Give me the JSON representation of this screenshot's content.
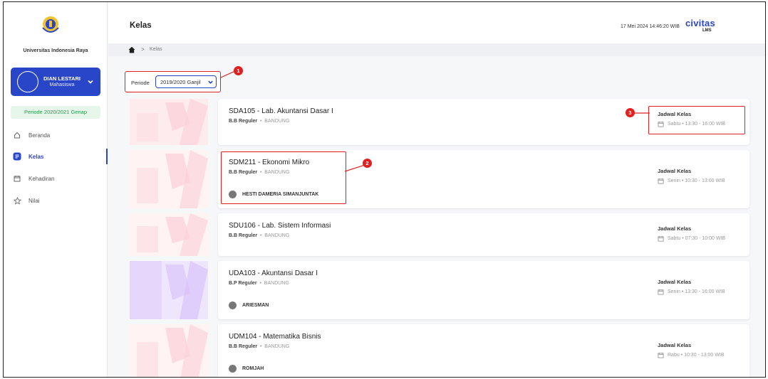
{
  "university": {
    "name": "Universitas Indonesia Raya",
    "logo_text": "Universitas Indonesia Raya"
  },
  "user": {
    "name": "DIAN LESTARI",
    "role": "Mahasiswa"
  },
  "sidebar": {
    "periode": "Periode 2020/2021 Genap",
    "items": [
      {
        "label": "Beranda",
        "icon": "home-outline-icon"
      },
      {
        "label": "Kelas",
        "icon": "class-icon",
        "active": true
      },
      {
        "label": "Kehadiran",
        "icon": "calendar-icon"
      },
      {
        "label": "Nilai",
        "icon": "star-icon"
      }
    ]
  },
  "header": {
    "title": "Kelas",
    "datetime": "17 Mei 2024 14:46:20 WIB",
    "brand": "civitas",
    "brand_sub": "LMS"
  },
  "breadcrumb": {
    "current": "Kelas",
    "separator": ">"
  },
  "filter": {
    "label": "Periode",
    "value": "2019/2020 Ganjil"
  },
  "markers": [
    "1",
    "2",
    "3"
  ],
  "schedule_heading": "Jadwal Kelas",
  "classes": [
    {
      "title": "SDA105 - Lab. Akuntansi Dasar I",
      "program": "B.B Reguler",
      "location": "BANDUNG",
      "lecturer": "",
      "schedule": "Sabtu • 13:30 - 16:00 WIB"
    },
    {
      "title": "SDM211 - Ekonomi Mikro",
      "program": "B.B Reguler",
      "location": "BANDUNG",
      "lecturer": "HESTI DAMERIA SIMANJUNTAK",
      "schedule": "Senin • 10:30 - 13:00 WIB"
    },
    {
      "title": "SDU106 - Lab. Sistem Informasi",
      "program": "B.B Reguler",
      "location": "BANDUNG",
      "lecturer": "",
      "schedule": "Sabtu • 07:30 - 10:00 WIB"
    },
    {
      "title": "UDA103 - Akuntansi Dasar I",
      "program": "B.P Reguler",
      "location": "BANDUNG",
      "lecturer": "ARIESMAN",
      "schedule": "Senin • 13:30 - 16:00 WIB"
    },
    {
      "title": "UDM104 - Matematika Bisnis",
      "program": "B.B Reguler",
      "location": "BANDUNG",
      "lecturer": "ROMJAH",
      "schedule": "Rabu • 10:30 - 13:00 WIB"
    }
  ],
  "colors": {
    "accent": "#2a46c8",
    "highlight": "#e02020",
    "periode_text": "#2a9a4f"
  }
}
